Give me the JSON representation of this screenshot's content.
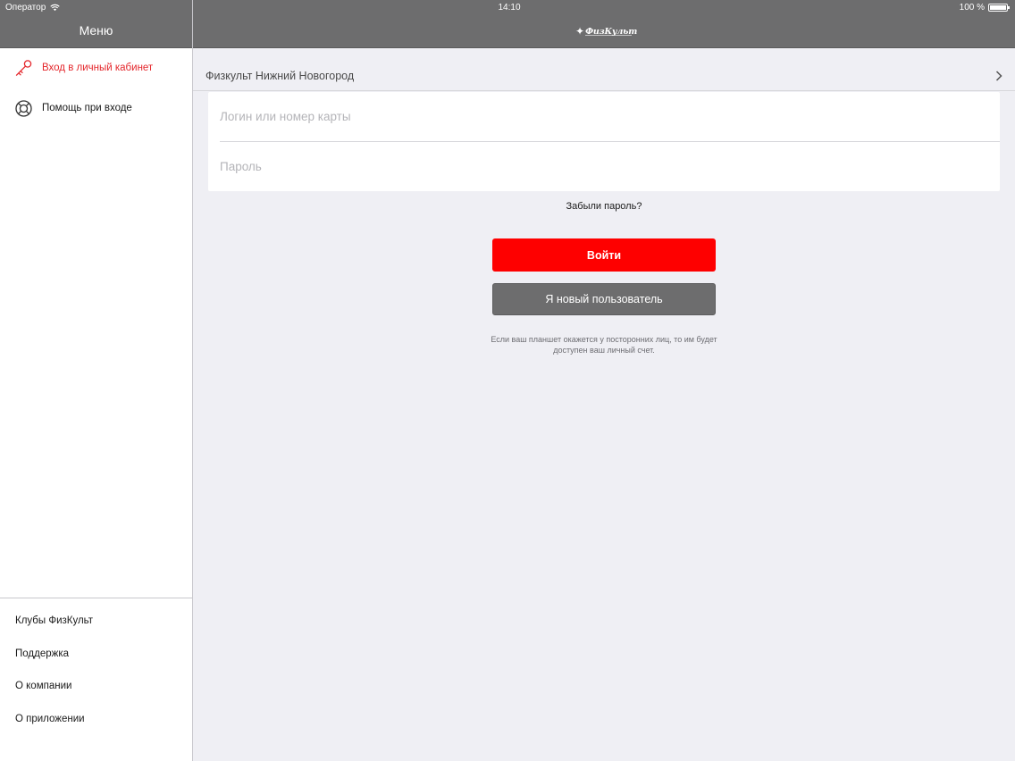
{
  "status_bar": {
    "carrier": "Оператор",
    "time": "14:10",
    "battery": "100 %"
  },
  "sidebar": {
    "title": "Меню",
    "items": [
      {
        "label": "Вход в личный кабинет",
        "icon": "key-icon",
        "active": true
      },
      {
        "label": "Помощь при входе",
        "icon": "lifebuoy-icon",
        "active": false
      }
    ],
    "bottom_items": [
      {
        "label": "Клубы ФизКульт"
      },
      {
        "label": "Поддержка"
      },
      {
        "label": "О компании"
      },
      {
        "label": "О приложении"
      }
    ]
  },
  "header": {
    "logo_text": "ФизКульт"
  },
  "club_selector": {
    "label": "Физкульт Нижний Новогород",
    "icon": "chevron-right-icon"
  },
  "login_form": {
    "login_placeholder": "Логин или номер карты",
    "login_value": "",
    "password_placeholder": "Пароль",
    "password_value": ""
  },
  "forgot_password": "Забыли пароль?",
  "buttons": {
    "login": "Войти",
    "new_user": "Я новый пользователь"
  },
  "note": "Если ваш планшет окажется у посторонних лиц, то им будет доступен ваш личный счет.",
  "colors": {
    "accent_red": "#fe0000",
    "active_text": "#e4262b",
    "header_gray": "#6d6d6e",
    "background": "#efeff4"
  }
}
